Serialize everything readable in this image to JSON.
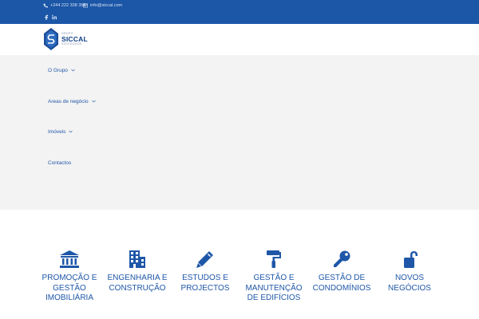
{
  "topbar": {
    "phone": "+244 222 338 358",
    "email": "info@siccal.com",
    "social": [
      "facebook-icon",
      "linkedin-icon"
    ]
  },
  "logo": {
    "top": "GRUPO",
    "main": "SICCAL",
    "sub": "SOCIEDADE"
  },
  "nav": {
    "items": [
      {
        "label": "O Grupo",
        "has_dropdown": true
      },
      {
        "label": "Areas de negócio",
        "has_dropdown": true
      },
      {
        "label": "Imóveis",
        "has_dropdown": true
      },
      {
        "label": "Contactos",
        "has_dropdown": false
      }
    ]
  },
  "services": [
    {
      "label": "Promoção e\nGestão\nImobiliária",
      "icon": "bank-icon"
    },
    {
      "label": "Engenharia e\nConstrução",
      "icon": "building-icon"
    },
    {
      "label": "Estudos e\nProjectos",
      "icon": "pencil-icon"
    },
    {
      "label": "Gestão e\nManutenção\nde Edifícios",
      "icon": "paint-roller-icon"
    },
    {
      "label": "Gestão de\nCondomínios",
      "icon": "key-icon"
    },
    {
      "label": "Novos\nNegócios",
      "icon": "unlock-icon"
    }
  ],
  "colors": {
    "brand_blue": "#1b56a7",
    "nav_background": "#f3f3f3",
    "text_blue": "#1f57a8"
  }
}
